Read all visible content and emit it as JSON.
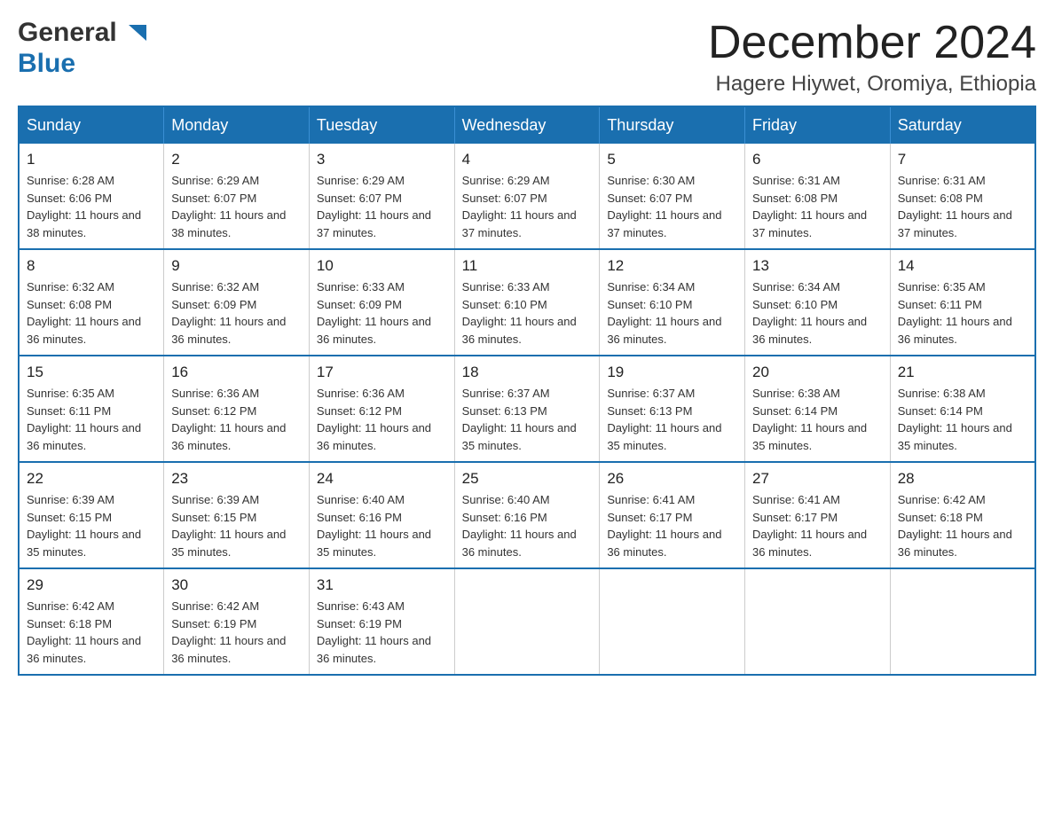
{
  "logo": {
    "line1": "General",
    "line2": "Blue"
  },
  "header": {
    "month": "December 2024",
    "location": "Hagere Hiywet, Oromiya, Ethiopia"
  },
  "days_of_week": [
    "Sunday",
    "Monday",
    "Tuesday",
    "Wednesday",
    "Thursday",
    "Friday",
    "Saturday"
  ],
  "weeks": [
    [
      {
        "day": "1",
        "sunrise": "6:28 AM",
        "sunset": "6:06 PM",
        "daylight": "11 hours and 38 minutes."
      },
      {
        "day": "2",
        "sunrise": "6:29 AM",
        "sunset": "6:07 PM",
        "daylight": "11 hours and 38 minutes."
      },
      {
        "day": "3",
        "sunrise": "6:29 AM",
        "sunset": "6:07 PM",
        "daylight": "11 hours and 37 minutes."
      },
      {
        "day": "4",
        "sunrise": "6:29 AM",
        "sunset": "6:07 PM",
        "daylight": "11 hours and 37 minutes."
      },
      {
        "day": "5",
        "sunrise": "6:30 AM",
        "sunset": "6:07 PM",
        "daylight": "11 hours and 37 minutes."
      },
      {
        "day": "6",
        "sunrise": "6:31 AM",
        "sunset": "6:08 PM",
        "daylight": "11 hours and 37 minutes."
      },
      {
        "day": "7",
        "sunrise": "6:31 AM",
        "sunset": "6:08 PM",
        "daylight": "11 hours and 37 minutes."
      }
    ],
    [
      {
        "day": "8",
        "sunrise": "6:32 AM",
        "sunset": "6:08 PM",
        "daylight": "11 hours and 36 minutes."
      },
      {
        "day": "9",
        "sunrise": "6:32 AM",
        "sunset": "6:09 PM",
        "daylight": "11 hours and 36 minutes."
      },
      {
        "day": "10",
        "sunrise": "6:33 AM",
        "sunset": "6:09 PM",
        "daylight": "11 hours and 36 minutes."
      },
      {
        "day": "11",
        "sunrise": "6:33 AM",
        "sunset": "6:10 PM",
        "daylight": "11 hours and 36 minutes."
      },
      {
        "day": "12",
        "sunrise": "6:34 AM",
        "sunset": "6:10 PM",
        "daylight": "11 hours and 36 minutes."
      },
      {
        "day": "13",
        "sunrise": "6:34 AM",
        "sunset": "6:10 PM",
        "daylight": "11 hours and 36 minutes."
      },
      {
        "day": "14",
        "sunrise": "6:35 AM",
        "sunset": "6:11 PM",
        "daylight": "11 hours and 36 minutes."
      }
    ],
    [
      {
        "day": "15",
        "sunrise": "6:35 AM",
        "sunset": "6:11 PM",
        "daylight": "11 hours and 36 minutes."
      },
      {
        "day": "16",
        "sunrise": "6:36 AM",
        "sunset": "6:12 PM",
        "daylight": "11 hours and 36 minutes."
      },
      {
        "day": "17",
        "sunrise": "6:36 AM",
        "sunset": "6:12 PM",
        "daylight": "11 hours and 36 minutes."
      },
      {
        "day": "18",
        "sunrise": "6:37 AM",
        "sunset": "6:13 PM",
        "daylight": "11 hours and 35 minutes."
      },
      {
        "day": "19",
        "sunrise": "6:37 AM",
        "sunset": "6:13 PM",
        "daylight": "11 hours and 35 minutes."
      },
      {
        "day": "20",
        "sunrise": "6:38 AM",
        "sunset": "6:14 PM",
        "daylight": "11 hours and 35 minutes."
      },
      {
        "day": "21",
        "sunrise": "6:38 AM",
        "sunset": "6:14 PM",
        "daylight": "11 hours and 35 minutes."
      }
    ],
    [
      {
        "day": "22",
        "sunrise": "6:39 AM",
        "sunset": "6:15 PM",
        "daylight": "11 hours and 35 minutes."
      },
      {
        "day": "23",
        "sunrise": "6:39 AM",
        "sunset": "6:15 PM",
        "daylight": "11 hours and 35 minutes."
      },
      {
        "day": "24",
        "sunrise": "6:40 AM",
        "sunset": "6:16 PM",
        "daylight": "11 hours and 35 minutes."
      },
      {
        "day": "25",
        "sunrise": "6:40 AM",
        "sunset": "6:16 PM",
        "daylight": "11 hours and 36 minutes."
      },
      {
        "day": "26",
        "sunrise": "6:41 AM",
        "sunset": "6:17 PM",
        "daylight": "11 hours and 36 minutes."
      },
      {
        "day": "27",
        "sunrise": "6:41 AM",
        "sunset": "6:17 PM",
        "daylight": "11 hours and 36 minutes."
      },
      {
        "day": "28",
        "sunrise": "6:42 AM",
        "sunset": "6:18 PM",
        "daylight": "11 hours and 36 minutes."
      }
    ],
    [
      {
        "day": "29",
        "sunrise": "6:42 AM",
        "sunset": "6:18 PM",
        "daylight": "11 hours and 36 minutes."
      },
      {
        "day": "30",
        "sunrise": "6:42 AM",
        "sunset": "6:19 PM",
        "daylight": "11 hours and 36 minutes."
      },
      {
        "day": "31",
        "sunrise": "6:43 AM",
        "sunset": "6:19 PM",
        "daylight": "11 hours and 36 minutes."
      },
      null,
      null,
      null,
      null
    ]
  ],
  "labels": {
    "sunrise": "Sunrise:",
    "sunset": "Sunset:",
    "daylight": "Daylight:"
  }
}
